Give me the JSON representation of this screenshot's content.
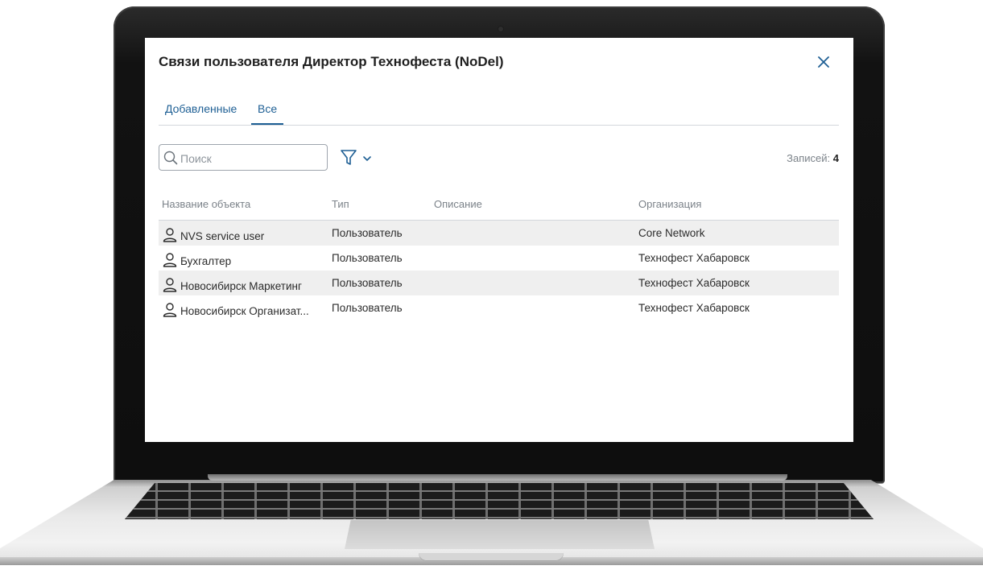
{
  "dialog": {
    "title": "Связи пользователя Директор Технофеста (NoDel)",
    "close_icon": "close-icon"
  },
  "tabs": [
    {
      "label": "Добавленные",
      "active": false
    },
    {
      "label": "Все",
      "active": true
    }
  ],
  "toolbar": {
    "search_placeholder": "Поиск",
    "search_value": "",
    "filter_icon": "filter-icon",
    "records_label": "Записей:",
    "records_count": "4"
  },
  "table": {
    "columns": [
      "Название объекта",
      "Тип",
      "Описание",
      "Организация"
    ],
    "rows": [
      {
        "name": "NVS service user",
        "type": "Пользователь",
        "description": "",
        "org": "Core Network",
        "icon": "user-icon"
      },
      {
        "name": "Бухгалтер",
        "type": "Пользователь",
        "description": "",
        "org": "Технофест Хабаровск",
        "icon": "user-icon"
      },
      {
        "name": "Новосибирск Маркетинг",
        "type": "Пользователь",
        "description": "",
        "org": "Технофест Хабаровск",
        "icon": "user-icon"
      },
      {
        "name": "Новосибирск Организат...",
        "type": "Пользователь",
        "description": "",
        "org": "Технофест Хабаровск",
        "icon": "user-icon"
      }
    ]
  },
  "colors": {
    "accent": "#1e5f94",
    "row_alt": "#efefef",
    "muted_text": "#7b8289"
  }
}
